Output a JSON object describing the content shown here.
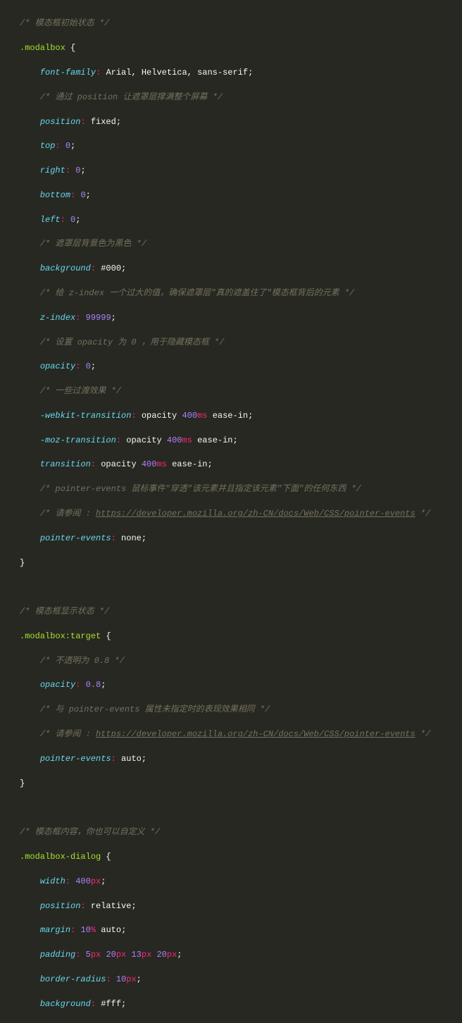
{
  "code": {
    "comment_modalbox_init": "/* 模态框初始状态 */",
    "sel_modalbox": ".modalbox",
    "open_brace": " {",
    "close_brace": "}",
    "prop_font_family": "font-family",
    "val_font_family_1": "Arial",
    "val_font_family_2": "Helvetica",
    "val_font_family_3": "sans-serif",
    "comment_position": "/* 通过 position 让遮罩层撑满整个屏幕 */",
    "prop_position": "position",
    "val_fixed": "fixed",
    "prop_top": "top",
    "prop_right": "right",
    "prop_bottom": "bottom",
    "prop_left": "left",
    "val_zero": "0",
    "comment_bg_black": "/* 遮罩层背景色为黑色 */",
    "prop_background": "background",
    "val_bg_black": "#000",
    "comment_zindex": "/* 给 z-index 一个过大的值，确保遮罩层\"真的遮盖住了\"模态框背后的元素 */",
    "prop_zindex": "z-index",
    "val_zindex": "99999",
    "comment_opacity0": "/* 设置 opacity 为 0 ，用于隐藏模态框 */",
    "prop_opacity": "opacity",
    "val_opacity0": "0",
    "comment_transitions": "/* 一些过渡效果 */",
    "prop_webkit_transition": "-webkit-transition",
    "prop_moz_transition": "-moz-transition",
    "prop_transition": "transition",
    "val_transition_prop": "opacity",
    "val_transition_dur": "400",
    "val_transition_ms": "ms",
    "val_transition_ease": "ease-in",
    "comment_pointer_events_desc": "/* pointer-events 鼠标事件\"穿透\"该元素并且指定该元素\"下面\"的任何东西 */",
    "comment_see_prefix": "/* 请参阅 : ",
    "comment_see_suffix": " */",
    "link_pointer_events": "https://developer.mozilla.org/zh-CN/docs/Web/CSS/pointer-events",
    "prop_pointer_events": "pointer-events",
    "val_none": "none",
    "comment_modalbox_show": "/* 模态框显示状态 */",
    "sel_modalbox_target": ".modalbox:target",
    "comment_opacity08": "/* 不透明为 0.8 */",
    "val_opacity08": "0.8",
    "comment_pe_same": "/* 与 pointer-events 属性未指定时的表现效果相同 */",
    "val_auto": "auto",
    "comment_dialog": "/* 模态框内容，你也可以自定义 */",
    "sel_modalbox_dialog": ".modalbox-dialog",
    "prop_width": "width",
    "val_width": "400",
    "unit_px": "px",
    "val_relative": "relative",
    "prop_margin": "margin",
    "val_margin_pct": "10",
    "unit_pct": "%",
    "prop_padding": "padding",
    "val_pad_5": "5",
    "val_pad_20": "20",
    "val_pad_13": "13",
    "prop_border_radius": "border-radius",
    "val_border_radius": "10",
    "val_bg_white": "#fff"
  }
}
